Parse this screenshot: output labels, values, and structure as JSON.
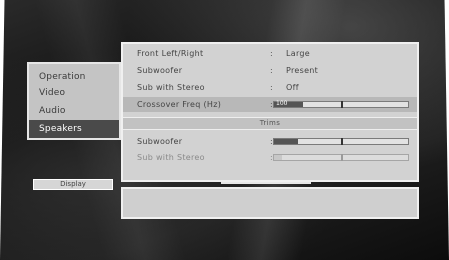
{
  "left_menu": {
    "items": [
      {
        "label": "Operation",
        "selected": false
      },
      {
        "label": "Video",
        "selected": false
      },
      {
        "label": "Audio",
        "selected": false
      },
      {
        "label": "Speakers",
        "selected": true
      }
    ]
  },
  "display_button": {
    "label": "Display"
  },
  "settings": {
    "rows": [
      {
        "label": "Front Left/Right",
        "value": "Large"
      },
      {
        "label": "Subwoofer",
        "value": "Present"
      },
      {
        "label": "Sub with Stereo",
        "value": "Off"
      },
      {
        "label": "Crossover Freq (Hz)",
        "slider_text": "100",
        "slider_level": 0.22,
        "knob_level": 0.5
      }
    ],
    "trims_header": "Trims",
    "trim_rows": [
      {
        "label": "Subwoofer",
        "slider_level": 0.18,
        "knob_level": 0.5
      },
      {
        "label": "Sub with Stereo",
        "slider_level": 0.06,
        "knob_level": 0.5,
        "disabled": true
      }
    ]
  },
  "colors": {
    "panel_bg": "#d2d2d2",
    "selected_bg": "#4a4a4a",
    "screen_bg": "#1a1a1a"
  }
}
